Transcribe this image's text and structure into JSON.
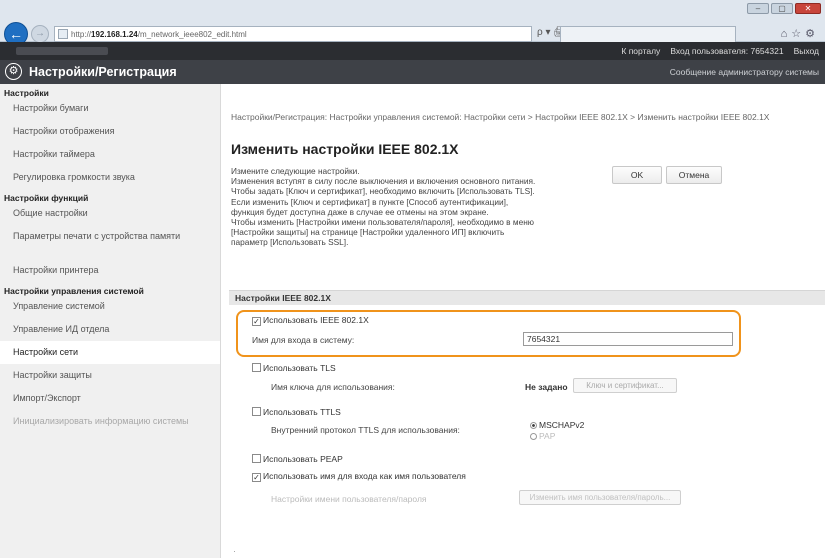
{
  "browser": {
    "url_prefix": "http://",
    "url_host": "192.168.1.24",
    "url_path": "/m_network_ieee802_edit.html",
    "search_label": "ρ ▾ 🖨 ◶",
    "window_buttons": [
      "–",
      "▢",
      "✕"
    ]
  },
  "topbar": {
    "portal_link": "К порталу",
    "login_label": "Вход пользователя:",
    "login_user": "7654321",
    "logout_link": "Выход"
  },
  "header": {
    "title": "Настройки/Регистрация",
    "admin_message": "Сообщение администратору системы"
  },
  "sidebar": {
    "sections": [
      {
        "title": "Настройки",
        "items": [
          "Настройки бумаги",
          "Настройки отображения",
          "Настройки таймера",
          "Регулировка громкости звука"
        ]
      },
      {
        "title": "Настройки функций",
        "items": [
          "Общие настройки",
          "Параметры печати с устройства памяти",
          "Настройки принтера"
        ]
      },
      {
        "title": "Настройки управления системой",
        "items": [
          "Управление системой",
          "Управление ИД отдела",
          "Настройки сети",
          "Настройки защиты",
          "Импорт/Экспорт",
          "Инициализировать информацию системы"
        ]
      }
    ]
  },
  "main": {
    "breadcrumb": "Настройки/Регистрация: Настройки управления системой: Настройки сети > Настройки IEEE 802.1X > Изменить настройки IEEE 802.1X",
    "page_title": "Изменить настройки IEEE 802.1X",
    "description": "Измените следующие настройки.\nИзменения вступят в силу после выключения и включения основного питания.\nЧтобы задать [Ключ и сертификат], необходимо включить [Использовать TLS].\nЕсли изменить [Ключ и сертификат] в пункте [Способ аутентификации],\nфункция будет доступна даже в случае ее отмены на этом экране.\nЧтобы изменить [Настройки имени пользователя/пароля], необходимо в меню\n[Настройки защиты] на странице [Настройки удаленного ИП] включить\nпараметр [Использовать SSL].",
    "ok_label": "OK",
    "cancel_label": "Отмена",
    "section_title": "Настройки IEEE 802.1X",
    "use_ieee": {
      "label": "Использовать IEEE 802.1X",
      "checked": true
    },
    "login_name": {
      "label": "Имя для входа в систему:",
      "value": "7654321"
    },
    "use_tls": {
      "label": "Использовать TLS",
      "checked": false
    },
    "key_name": {
      "label": "Имя ключа для использования:",
      "value": "Не задано",
      "button": "Ключ и сертификат..."
    },
    "use_ttls": {
      "label": "Использовать TTLS",
      "checked": false
    },
    "ttls_protocol": {
      "label": "Внутренний протокол TTLS для использования:",
      "options": [
        "MSCHAPv2",
        "PAP"
      ],
      "selected": "MSCHAPv2"
    },
    "use_peap": {
      "label": "Использовать PEAP",
      "checked": false
    },
    "use_login_as_user": {
      "label": "Использовать имя для входа как имя пользователя",
      "checked": true
    },
    "user_pass": {
      "label": "Настройки имени пользователя/пароля",
      "button": "Изменить имя пользователя/пароль..."
    }
  }
}
